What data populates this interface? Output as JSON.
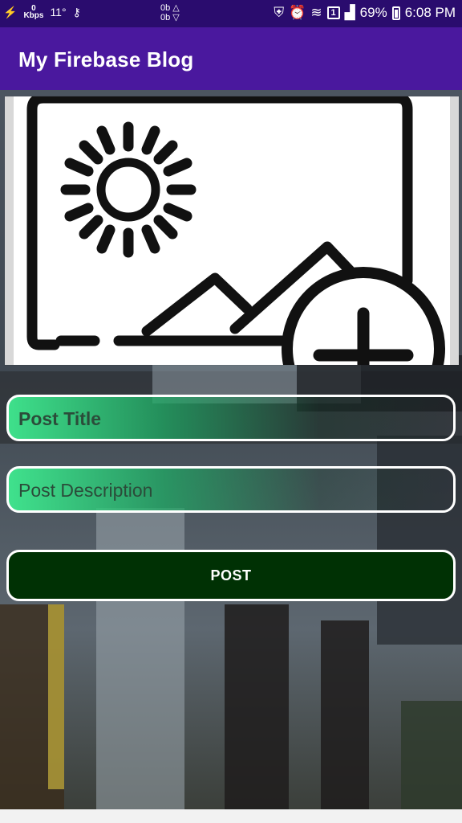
{
  "status_bar": {
    "speed_value": "0",
    "speed_unit": "Kbps",
    "temperature": "11°",
    "data_up": "0b",
    "data_down": "0b",
    "sim_slot": "1",
    "battery": "69%",
    "time": "6:08 PM"
  },
  "app_bar": {
    "title": "My Firebase Blog"
  },
  "image_picker": {
    "icon": "add-image-icon"
  },
  "form": {
    "title_placeholder": "Post Title",
    "description_placeholder": "Post Description",
    "post_label": "POST"
  },
  "colors": {
    "status_bar": "#2a0c6e",
    "app_bar": "#4a189e",
    "post_button": "#003104",
    "field_gradient_start": "#3fe98f"
  }
}
